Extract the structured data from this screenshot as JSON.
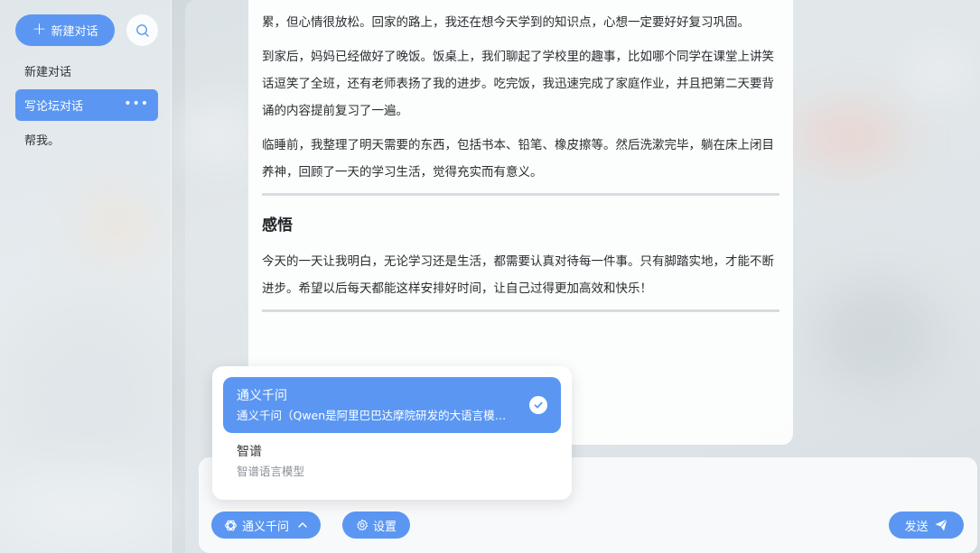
{
  "sidebar": {
    "new_chat_label": "新建对话",
    "conversations": [
      {
        "label": "新建对话",
        "active": false
      },
      {
        "label": "写论坛对话",
        "active": true
      },
      {
        "label": "帮我。",
        "active": false
      }
    ]
  },
  "message": {
    "paragraphs": [
      "累，但心情很放松。回家的路上，我还在想今天学到的知识点，心想一定要好好复习巩固。",
      "到家后，妈妈已经做好了晚饭。饭桌上，我们聊起了学校里的趣事，比如哪个同学在课堂上讲笑话逗笑了全班，还有老师表扬了我的进步。吃完饭，我迅速完成了家庭作业，并且把第二天要背诵的内容提前复习了一遍。",
      "临睡前，我整理了明天需要的东西，包括书本、铅笔、橡皮擦等。然后洗漱完毕，躺在床上闭目养神，回顾了一天的学习生活，觉得充实而有意义。"
    ],
    "section_heading": "感悟",
    "section_text": "今天的一天让我明白，无论学习还是生活，都需要认真对待每一件事。只有脚踏实地，才能不断进步。希望以后每天都能这样安排好时间，让自己过得更加高效和快乐！"
  },
  "model_menu": {
    "options": [
      {
        "name": "通义千问",
        "desc": "通义千问（Qwen是阿里巴巴达摩院研发的大语言模型）",
        "selected": true
      },
      {
        "name": "智谱",
        "desc": "智谱语言模型",
        "selected": false
      }
    ]
  },
  "toolbar": {
    "model_label": "通义千问",
    "settings_label": "设置",
    "send_label": "发送"
  },
  "colors": {
    "accent": "#5b97f2",
    "text": "#2a2d30"
  },
  "icons": {
    "new_chat": "plus-icon",
    "search": "search-icon",
    "more": "more-icon",
    "model": "openai-logo-icon",
    "chevron": "chevron-up-icon",
    "settings": "gear-icon",
    "send": "send-icon",
    "check": "check-icon"
  }
}
